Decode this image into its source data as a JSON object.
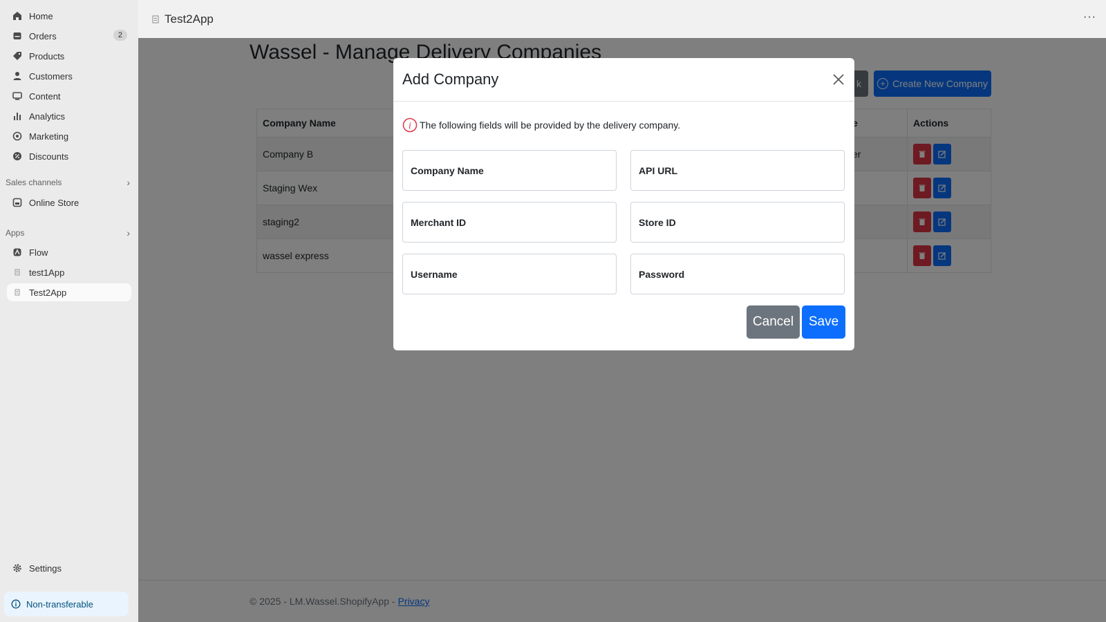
{
  "sidebar": {
    "items": [
      {
        "label": "Home",
        "icon": "home-icon"
      },
      {
        "label": "Orders",
        "icon": "orders-icon",
        "badge": "2"
      },
      {
        "label": "Products",
        "icon": "tag-icon"
      },
      {
        "label": "Customers",
        "icon": "person-icon"
      },
      {
        "label": "Content",
        "icon": "content-icon"
      },
      {
        "label": "Analytics",
        "icon": "bar-chart-icon"
      },
      {
        "label": "Marketing",
        "icon": "target-icon"
      },
      {
        "label": "Discounts",
        "icon": "discount-icon"
      }
    ],
    "sales_channels": {
      "title": "Sales channels",
      "items": [
        {
          "label": "Online Store",
          "icon": "store-icon"
        }
      ]
    },
    "apps": {
      "title": "Apps",
      "items": [
        {
          "label": "Flow",
          "icon": "flow-icon"
        },
        {
          "label": "test1App",
          "icon": "app-icon"
        },
        {
          "label": "Test2App",
          "icon": "app-icon",
          "active": true
        }
      ]
    },
    "settings": {
      "label": "Settings",
      "icon": "gear-icon"
    },
    "notice": {
      "label": "Non-transferable",
      "icon": "info-icon"
    }
  },
  "topbar": {
    "title": "Test2App",
    "more": "···"
  },
  "page": {
    "title": "Wassel - Manage Delivery Companies",
    "back_label": "k",
    "create_label": "Create New Company",
    "table": {
      "headers": [
        "Company Name",
        "",
        "e",
        "Actions"
      ],
      "rows": [
        {
          "name": "Company B",
          "col3": "er"
        },
        {
          "name": "Staging Wex",
          "col3": ""
        },
        {
          "name": "staging2",
          "col3": ""
        },
        {
          "name": "wassel express",
          "col3": ""
        }
      ]
    },
    "footer": {
      "text": "© 2025 - LM.Wassel.ShopifyApp -",
      "link": "Privacy"
    }
  },
  "modal": {
    "title": "Add Company",
    "info": "The following fields will be provided by the delivery company.",
    "fields": {
      "company_name": "Company Name",
      "api_url": "API URL",
      "merchant_id": "Merchant ID",
      "store_id": "Store ID",
      "username": "Username",
      "password": "Password"
    },
    "cancel_label": "Cancel",
    "save_label": "Save"
  },
  "colors": {
    "primary": "#0d6efd",
    "secondary": "#6c757d",
    "danger": "#dc3545",
    "info_red": "#dc3545"
  }
}
